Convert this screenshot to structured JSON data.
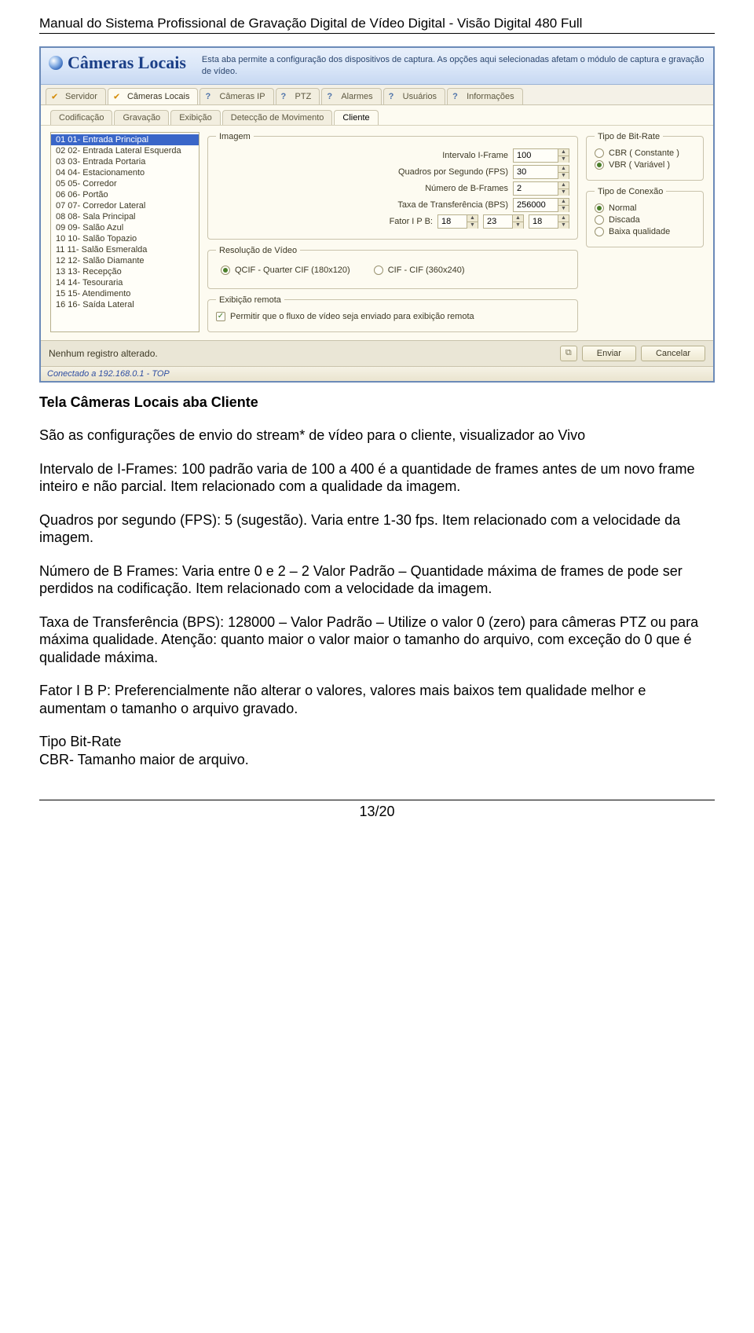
{
  "doc": {
    "header": "Manual do Sistema Profissional de Gravação Digital de Vídeo Digital  -  Visão Digital 480 Full",
    "footer": "13/20"
  },
  "titlebar": {
    "title": "Câmeras Locais",
    "description": "Esta aba permite a configuração dos dispositivos de captura. As opções aqui selecionadas afetam o módulo de captura e gravação de vídeo."
  },
  "mainTabs": [
    {
      "label": "Servidor",
      "checked": true
    },
    {
      "label": "Câmeras Locais",
      "checked": true,
      "active": true
    },
    {
      "label": "Câmeras IP"
    },
    {
      "label": "PTZ"
    },
    {
      "label": "Alarmes"
    },
    {
      "label": "Usuários"
    },
    {
      "label": "Informações"
    }
  ],
  "subTabs": [
    {
      "label": "Codificação"
    },
    {
      "label": "Gravação"
    },
    {
      "label": "Exibição"
    },
    {
      "label": "Detecção de Movimento"
    },
    {
      "label": "Cliente",
      "active": true
    }
  ],
  "cameras": [
    "01 01- Entrada Principal",
    "02 02- Entrada Lateral Esquerda",
    "03 03- Entrada Portaria",
    "04 04- Estacionamento",
    "05 05- Corredor",
    "06 06- Portão",
    "07 07- Corredor Lateral",
    "08 08- Sala Principal",
    "09 09- Salão Azul",
    "10 10- Salão Topazio",
    "11 11- Salão Esmeralda",
    "12 12- Salão Diamante",
    "13 13- Recepção",
    "14 14- Tesouraria",
    "15 15- Atendimento",
    "16 16- Saída Lateral"
  ],
  "imagem": {
    "legend": "Imagem",
    "iframe_label": "Intervalo I-Frame",
    "iframe_value": "100",
    "fps_label": "Quadros por Segundo (FPS)",
    "fps_value": "30",
    "bframes_label": "Número de B-Frames",
    "bframes_value": "2",
    "bps_label": "Taxa de Transferência (BPS)",
    "bps_value": "256000",
    "ipb_label": "Fator I P B:",
    "ipb_i": "18",
    "ipb_p": "23",
    "ipb_b": "18"
  },
  "bitrate": {
    "legend": "Tipo de Bit-Rate",
    "cbr": "CBR ( Constante )",
    "vbr": "VBR ( Variável )"
  },
  "conexao": {
    "legend": "Tipo de Conexão",
    "normal": "Normal",
    "discada": "Discada",
    "baixa": "Baixa qualidade"
  },
  "resolucao": {
    "legend": "Resolução de Vídeo",
    "qcif": "QCIF - Quarter CIF (180x120)",
    "cif": "CIF - CIF (360x240)"
  },
  "remota": {
    "legend": "Exibição remota",
    "permitir": "Permitir que o fluxo de vídeo seja enviado para exibição remota"
  },
  "toolbar": {
    "status": "Nenhum registro alterado.",
    "enviar": "Enviar",
    "cancelar": "Cancelar"
  },
  "statusbar": "Conectado a 192.168.0.1 - TOP",
  "body": {
    "title": "Tela Câmeras Locais aba Cliente",
    "p1": "São as configurações de envio do stream* de vídeo para o cliente, visualizador ao Vivo",
    "p2": "Intervalo de I-Frames: 100 padrão varia de 100 a 400 é a quantidade de frames antes de um novo frame inteiro e não parcial. Item relacionado com a qualidade da imagem.",
    "p3": "Quadros por segundo (FPS): 5 (sugestão). Varia entre 1-30 fps. Item relacionado com a velocidade da imagem.",
    "p4": "Número de B Frames: Varia entre 0 e 2 – 2  Valor Padrão – Quantidade máxima de frames de pode ser perdidos na codificação. Item relacionado com a velocidade da imagem.",
    "p5": "Taxa de Transferência (BPS): 128000 – Valor Padrão – Utilize o valor 0 (zero) para câmeras PTZ ou para máxima qualidade. Atenção: quanto maior o valor maior o tamanho do arquivo, com exceção do 0 que é qualidade máxima.",
    "p6": "Fator I B P: Preferencialmente não alterar o valores, valores mais baixos tem qualidade melhor e aumentam o tamanho o arquivo gravado.",
    "p7a": "Tipo Bit-Rate",
    "p7b": "CBR- Tamanho maior de arquivo."
  }
}
